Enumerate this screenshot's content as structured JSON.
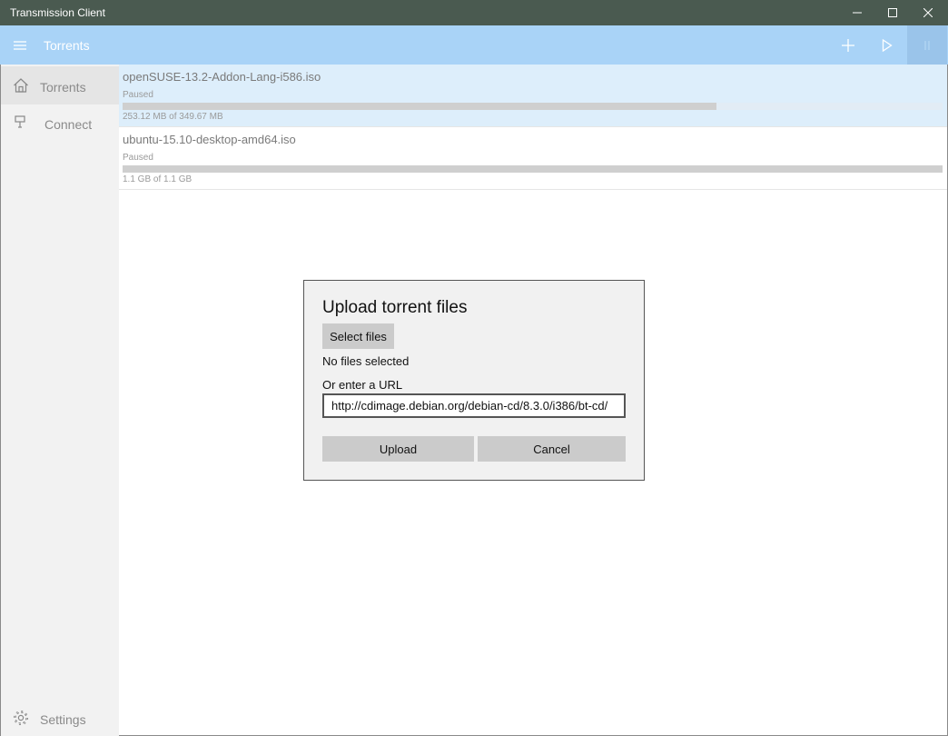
{
  "window": {
    "title": "Transmission Client",
    "controls": [
      "minimize-icon",
      "maximize-icon",
      "close-icon"
    ]
  },
  "appbar": {
    "title": "Torrents",
    "menu_icon": "hamburger-icon",
    "actions": [
      "add-icon",
      "play-icon",
      "pause-icon"
    ],
    "accent_color": "#a9d3f7"
  },
  "sidebar": {
    "items": [
      {
        "label": "Torrents",
        "icon": "home-icon",
        "selected": true
      },
      {
        "label": "Connect",
        "icon": "plug-icon",
        "selected": false
      }
    ],
    "settings": {
      "label": "Settings",
      "icon": "gear-icon"
    }
  },
  "torrents": [
    {
      "name": "openSUSE-13.2-Addon-Lang-i586.iso",
      "status": "Paused",
      "size": "253.12 MB of 349.67 MB",
      "progress": 0.724,
      "selected": true
    },
    {
      "name": "ubuntu-15.10-desktop-amd64.iso",
      "status": "Paused",
      "size": "1.1 GB of 1.1 GB",
      "progress": 1.0,
      "selected": false
    }
  ],
  "dialog": {
    "title": "Upload torrent files",
    "select_button": "Select files",
    "no_files": "No files selected",
    "url_label": "Or enter a URL",
    "url_value": "http://cdimage.debian.org/debian-cd/8.3.0/i386/bt-cd/",
    "upload_button": "Upload",
    "cancel_button": "Cancel"
  }
}
